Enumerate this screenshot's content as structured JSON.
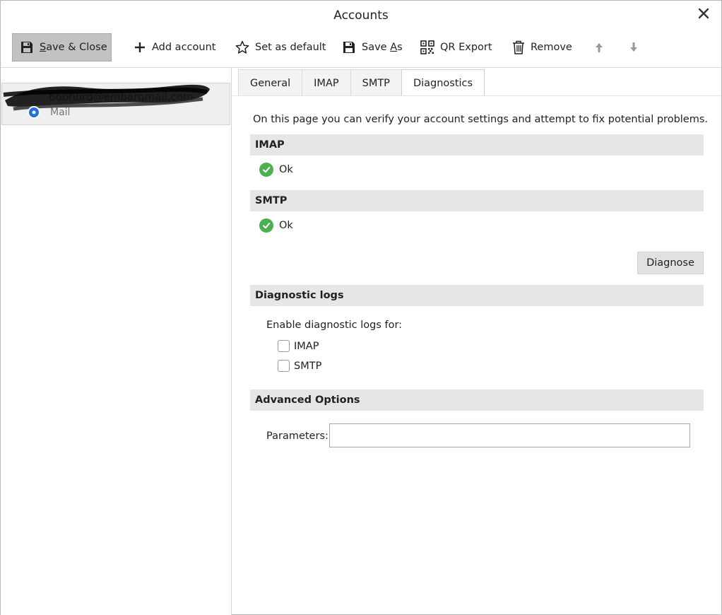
{
  "window": {
    "title": "Accounts",
    "close_icon": "close-icon"
  },
  "toolbar": {
    "save_close": {
      "pre": "",
      "ul": "S",
      "post": "ave & Close"
    },
    "add_account": "Add account",
    "set_default": "Set as default",
    "save_as": {
      "pre": "Save ",
      "ul": "A",
      "post": "s"
    },
    "qr_export": "QR Export",
    "remove": "Remove"
  },
  "sidebar": {
    "accounts": [
      {
        "email": "bobhurd@embarqmail.com",
        "type": "Mail"
      }
    ]
  },
  "tabs": [
    "General",
    "IMAP",
    "SMTP",
    "Diagnostics"
  ],
  "active_tab": "Diagnostics",
  "diagnostics": {
    "intro": "On this page you can verify your account settings and attempt to fix potential problems.",
    "imap": {
      "header": "IMAP",
      "status": "Ok"
    },
    "smtp": {
      "header": "SMTP",
      "status": "Ok"
    },
    "diagnose_button": "Diagnose",
    "logs": {
      "header": "Diagnostic logs",
      "enable_label": "Enable diagnostic logs for:",
      "options": [
        {
          "label": "IMAP",
          "checked": false
        },
        {
          "label": "SMTP",
          "checked": false
        }
      ]
    },
    "advanced": {
      "header": "Advanced Options",
      "parameters_label": "Parameters:",
      "parameters_value": ""
    }
  },
  "colors": {
    "ok_green": "#4caf50",
    "section_bg": "#e6e6e6",
    "active_button": "#c2c2c2",
    "account_badge": "#1f6fe0"
  }
}
